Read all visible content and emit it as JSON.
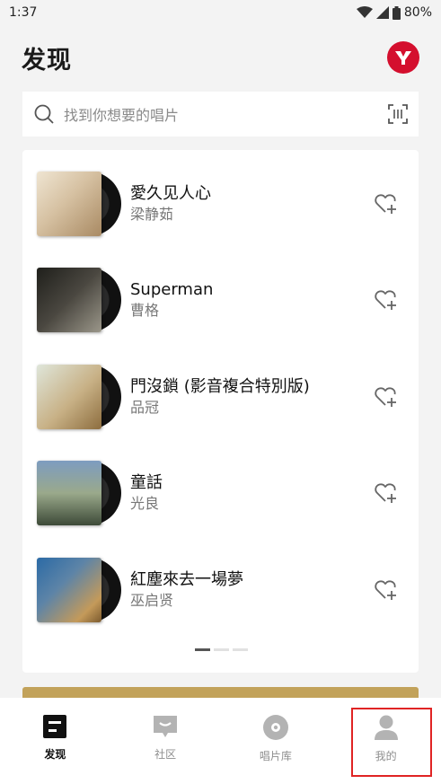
{
  "status": {
    "time": "1:37",
    "battery": "80%"
  },
  "header": {
    "title": "发现",
    "avatar_letter": "Y",
    "avatar_color": "#d40f2e"
  },
  "search": {
    "placeholder": "找到你想要的唱片"
  },
  "albums": [
    {
      "title": "愛久见人心",
      "artist": "梁静茹",
      "cover_colors": [
        "#e9dcc6",
        "#b79a78"
      ]
    },
    {
      "title": "Superman",
      "artist": "曹格",
      "cover_colors": [
        "#2a2a26",
        "#8d8a7e"
      ]
    },
    {
      "title": "門沒鎖 (影音複合特別版)",
      "artist": "品冠",
      "cover_colors": [
        "#cfd7c9",
        "#c8a36a"
      ]
    },
    {
      "title": "童話",
      "artist": "光良",
      "cover_colors": [
        "#6f8fb4",
        "#3c4a3a"
      ]
    },
    {
      "title": "紅塵來去一場夢",
      "artist": "巫启贤",
      "cover_colors": [
        "#2c6aa4",
        "#c49a5a"
      ]
    }
  ],
  "pager": {
    "count": 3,
    "active": 0
  },
  "tabs": [
    {
      "label": "发现",
      "icon": "discover-icon",
      "active": true
    },
    {
      "label": "社区",
      "icon": "community-icon",
      "active": false
    },
    {
      "label": "唱片库",
      "icon": "record-library-icon",
      "active": false
    },
    {
      "label": "我的",
      "icon": "profile-icon",
      "active": false
    }
  ],
  "colors": {
    "accent_gold": "#c2a25a",
    "highlight": "#e02424"
  }
}
